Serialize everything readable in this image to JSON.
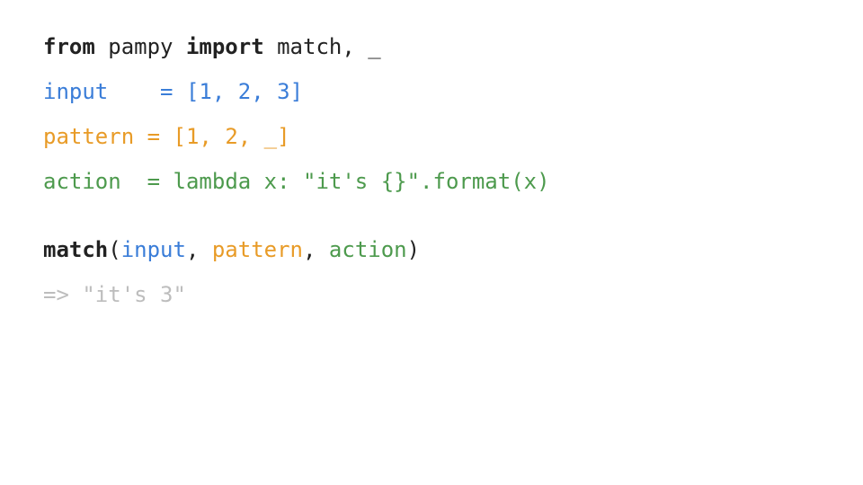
{
  "l1": {
    "from": "from",
    "module": " pampy ",
    "import": "import",
    "names": " match, _"
  },
  "l2": {
    "name": "input",
    "pad": "   ",
    "eq": " = ",
    "val": "[1, 2, 3]"
  },
  "l3": {
    "name": "pattern",
    "pad": " ",
    "eq": "= ",
    "val": "[1, 2, _]"
  },
  "l4": {
    "name": "action",
    "pad": "  ",
    "eq": "= ",
    "val": "lambda x: \"it's {}\".format(x)"
  },
  "l5": {
    "fn": "match",
    "open": "(",
    "arg1": "input",
    "sep1": ", ",
    "arg2": "pattern",
    "sep2": ", ",
    "arg3": "action",
    "close": ")"
  },
  "l6": {
    "out": "=> \"it's 3\""
  }
}
